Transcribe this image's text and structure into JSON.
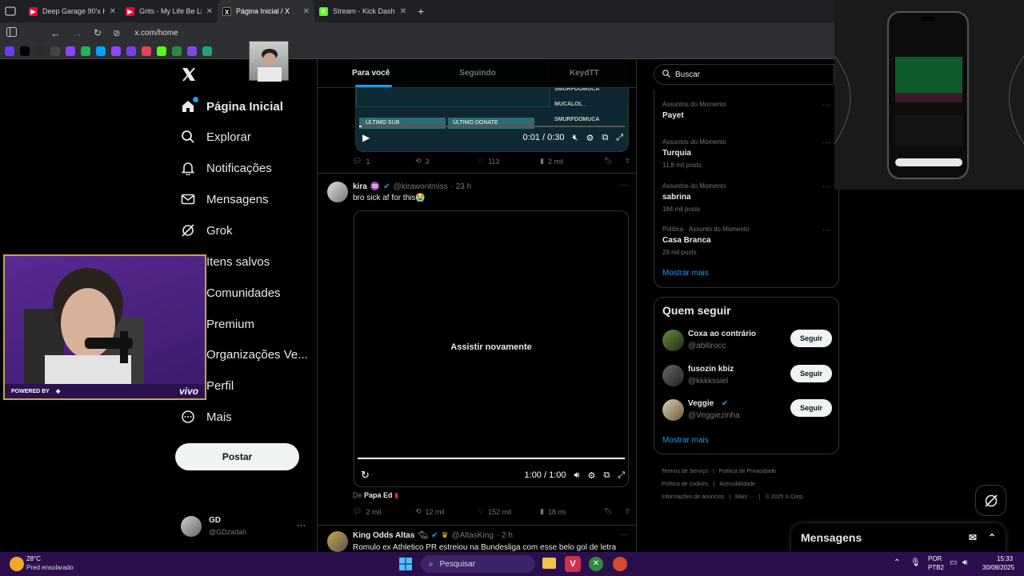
{
  "browser": {
    "tabs": [
      {
        "title": "Deep Garage 90's House",
        "color": "#ff0033",
        "glyph": "▶"
      },
      {
        "title": "Grits - My Life Be Like",
        "color": "#ff0033",
        "glyph": "▶"
      },
      {
        "title": "Página Inicial / X",
        "color": "#000000",
        "glyph": "X"
      },
      {
        "title": "Stream - Kick Dashboard",
        "color": "#53fc18",
        "glyph": "K"
      }
    ],
    "url": "x.com/home",
    "bookmarks": [
      "#6a3cf0",
      "#000000",
      "#2a2a2a",
      "#444444",
      "#8b44f7",
      "#1db954",
      "#00a3ff",
      "#9146ff",
      "#7a3cf0",
      "#e4405f",
      "#53fc18",
      "#2b8a3e",
      "#7b4ae2",
      "#1aa57a"
    ]
  },
  "nav": {
    "items": [
      {
        "label": "Página Inicial",
        "icon": "home-icon"
      },
      {
        "label": "Explorar",
        "icon": "search-icon"
      },
      {
        "label": "Notificações",
        "icon": "bell-icon"
      },
      {
        "label": "Mensagens",
        "icon": "mail-icon"
      },
      {
        "label": "Grok",
        "icon": "grok-icon"
      },
      {
        "label": "Itens salvos",
        "icon": "bookmark-icon"
      },
      {
        "label": "Comunidades",
        "icon": "communities-icon"
      },
      {
        "label": "Premium",
        "icon": "x-icon"
      },
      {
        "label": "Organizações Ve...",
        "icon": "lightning-icon"
      },
      {
        "label": "Perfil",
        "icon": "profile-icon"
      },
      {
        "label": "Mais",
        "icon": "more-circle-icon"
      }
    ],
    "post_label": "Postar",
    "account": {
      "name": "GD",
      "handle": "@GDzadah"
    }
  },
  "webcam": {
    "powered": "POWERED BY",
    "brand": "vivo"
  },
  "feed": {
    "tabs": [
      "Para você",
      "Seguindo",
      "KeydTT"
    ],
    "top_video": {
      "time": "0:01 / 0:30",
      "overlay_names": [
        "SMURFDOMUCA",
        "MUCALOL_",
        "SMURFDOMUCA"
      ],
      "overlay_labels": [
        "ÚLTIMO SUB",
        "ÚLTIMO DONATE"
      ],
      "stats": {
        "replies": "1",
        "reposts": "3",
        "likes": "113",
        "views": "2 mil"
      }
    },
    "post2": {
      "name": "kira",
      "handle": "@kirawontmiss",
      "age": "· 23 h",
      "text": "bro sick af for this😭",
      "replay": "Assistir novamente",
      "time": "1:00 / 1:00",
      "from_prefix": "De",
      "from_name": "Papa Ed",
      "stats": {
        "replies": "2 mil",
        "reposts": "12 mil",
        "likes": "152 mil",
        "views": "18 mi"
      }
    },
    "post3": {
      "name": "King Odds Altas",
      "handle": "@AltasKing",
      "age": "· 2 h",
      "text": "Romulo ex Athletico PR estreiou na Bundesliga com esse belo gol de letra"
    }
  },
  "sidebar": {
    "search_placeholder": "Buscar",
    "trends": [
      {
        "context": "Assuntos do Momento",
        "name": "Payet",
        "count": ""
      },
      {
        "context": "Assuntos do Momento",
        "name": "Turquia",
        "count": "11,8 mil posts"
      },
      {
        "context": "Assuntos do Momento",
        "name": "sabrina",
        "count": "184 mil posts"
      },
      {
        "context": "Política · Assunto do Momento",
        "name": "Casa Branca",
        "count": "28 mil posts"
      }
    ],
    "show_more": "Mostrar mais",
    "follow_title": "Quem seguir",
    "follow": [
      {
        "name": "Coxa ao contrário",
        "handle": "@abitirocc",
        "button": "Seguir"
      },
      {
        "name": "fusozin kbiz",
        "handle": "@kkkkssiel",
        "button": "Seguir"
      },
      {
        "name": "Veggie",
        "handle": "@Veggiezinha",
        "button": "Seguir"
      }
    ],
    "follow_more": "Mostrar mais",
    "footer": [
      "Termos de Serviço",
      "Política de Privacidade",
      "Política de cookies",
      "Acessibilidade",
      "Informações de anúncios",
      "Mais ···",
      "© 2025 X Corp."
    ]
  },
  "messages": {
    "title": "Mensagens"
  },
  "taskbar": {
    "weather_temp": "28°C",
    "weather_desc": "Pred ensolarado",
    "search": "Pesquisar",
    "lang": "POR",
    "layout": "PTB2",
    "time": "15:33",
    "date": "30/08/2025"
  }
}
